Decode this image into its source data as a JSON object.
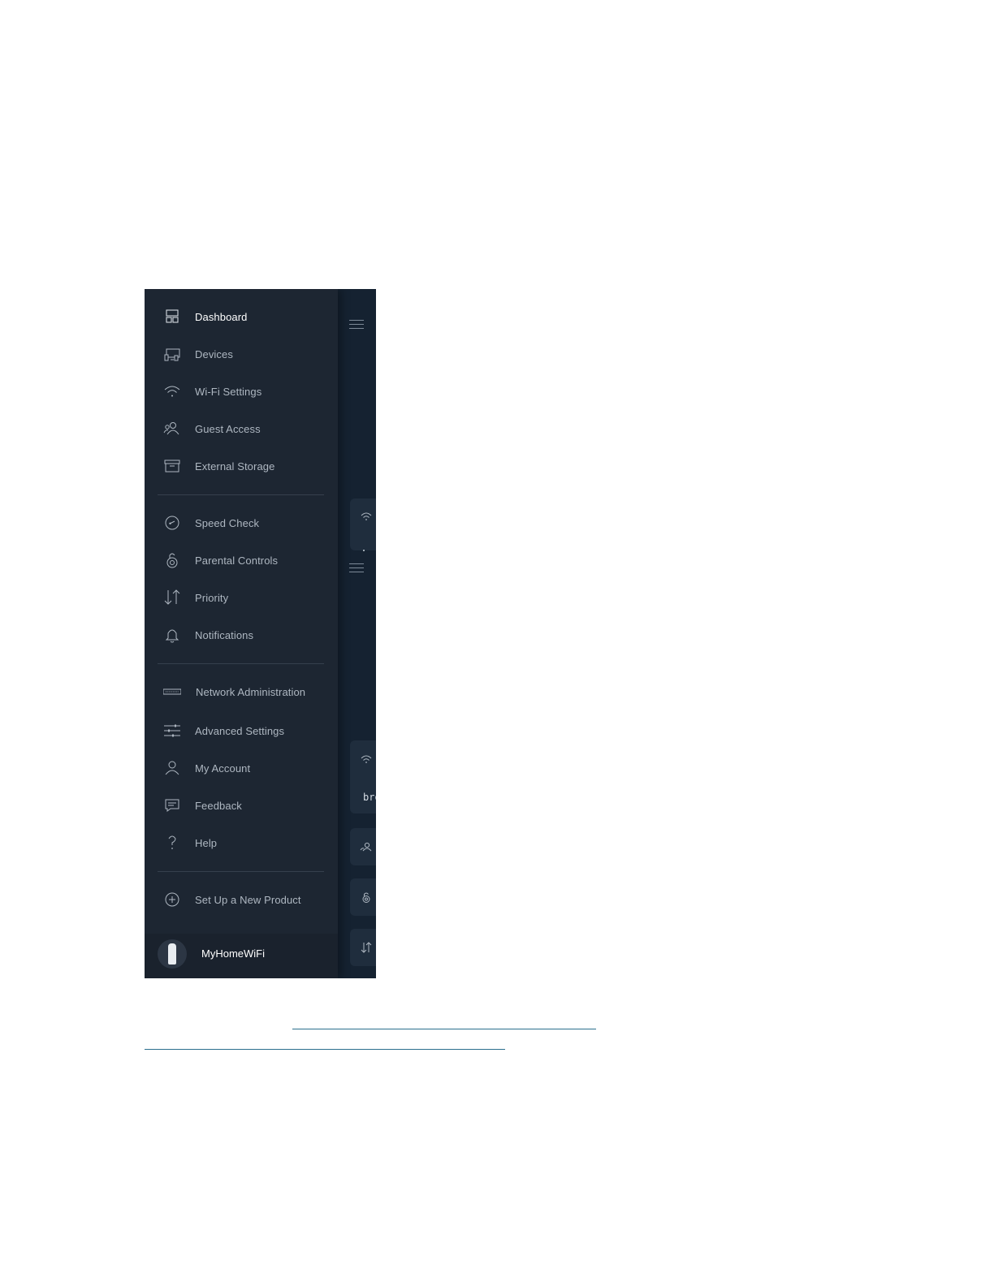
{
  "menu": {
    "items": [
      {
        "label": "Dashboard",
        "icon": "dashboard-icon",
        "active": true
      },
      {
        "label": "Devices",
        "icon": "devices-icon"
      },
      {
        "label": "Wi-Fi Settings",
        "icon": "wifi-icon"
      },
      {
        "label": "Guest Access",
        "icon": "guest-icon"
      },
      {
        "label": "External Storage",
        "icon": "storage-icon"
      },
      {
        "label": "Speed Check",
        "icon": "speedometer-icon"
      },
      {
        "label": "Parental Controls",
        "icon": "lock-icon"
      },
      {
        "label": "Priority",
        "icon": "priority-arrows-icon"
      },
      {
        "label": "Notifications",
        "icon": "bell-icon"
      },
      {
        "label": "Network Administration",
        "icon": "router-icon"
      },
      {
        "label": "Advanced Settings",
        "icon": "sliders-icon"
      },
      {
        "label": "My Account",
        "icon": "person-icon"
      },
      {
        "label": "Feedback",
        "icon": "chat-bubble-icon"
      },
      {
        "label": "Help",
        "icon": "question-icon"
      },
      {
        "label": "Set Up a New Product",
        "icon": "plus-circle-icon"
      }
    ]
  },
  "footer": {
    "network_name": "MyHomeWiFi",
    "icon": "velop-node-icon"
  },
  "background_content": {
    "card_text": "bro"
  },
  "colors": {
    "drawer_bg": "#1d2632",
    "app_bg": "#152231",
    "label": "#aeb7c1",
    "active_label": "#ffffff",
    "link": "#2b6f8e"
  }
}
